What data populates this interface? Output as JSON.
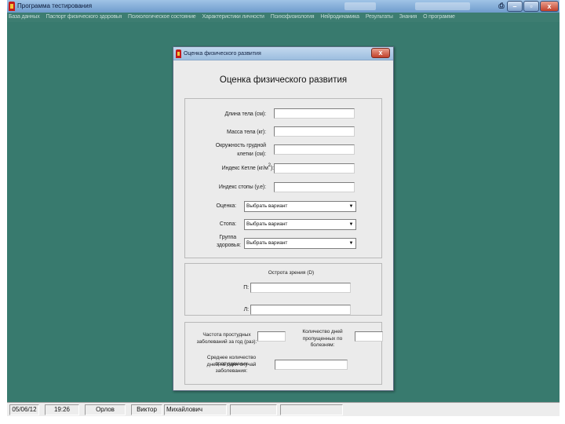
{
  "window": {
    "title": "Программа тестирования"
  },
  "menubar": {
    "items": [
      "База данных",
      "Паспорт физического здоровья",
      "Психологическое состояние",
      "Характеристики личности",
      "Психофизиология",
      "Нейродинамика",
      "Результаты",
      "Знания",
      "О программе"
    ]
  },
  "dialog": {
    "title": "Оценка физического развития",
    "close_label": "x",
    "heading": "Оценка физического развития",
    "fields": {
      "body_length_label": "Длина тела (см):",
      "body_mass_label": "Масса тела (кг):",
      "chest_label_1": "Окружность грудной",
      "chest_label_2": "клетки (см):",
      "quetelet_label": "Индекс Кетле (кг/м",
      "quetelet_sup": "2",
      "quetelet_end": "):",
      "foot_index_label": "Индекс стопы (у.е):",
      "score_label": "Оценка:",
      "foot_label": "Стопа:",
      "health_group_label_1": "Группа",
      "health_group_label_2": "здоровья:"
    },
    "combo_placeholder": "Выбрать вариант",
    "visual_acuity": {
      "title": "Острота зрения (D)",
      "right_label": "П:",
      "left_label": "Л:"
    },
    "illness": {
      "colds_label_1": "Частота простудных",
      "colds_label_2": "заболеваний за год (раз):",
      "missed_label_1": "Количество дней",
      "missed_label_2": "пропущенных по болезням:",
      "avg_label_1": "Среднее количество пропущенных",
      "avg_label_2": "дней на один случай заболевания:"
    }
  },
  "statusbar": {
    "date": "05/06/12",
    "time": "19:26",
    "last_name": "Орлов",
    "first_name": "Виктор",
    "patronymic": "Михайлович"
  },
  "colors": {
    "desktop": "#387a6e",
    "dialog": "#ebebeb"
  }
}
